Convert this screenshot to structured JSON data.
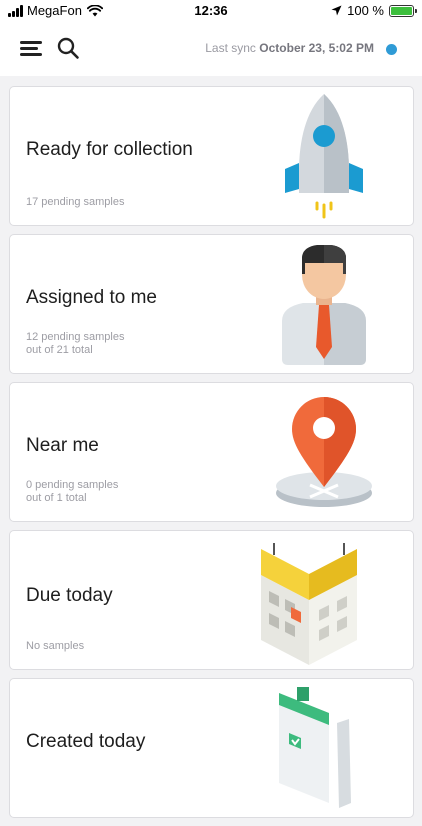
{
  "status_bar": {
    "carrier": "MegaFon",
    "time": "12:36",
    "battery": "100 %"
  },
  "header": {
    "sync_label": "Last sync",
    "sync_time": "October 23, 5:02 PM",
    "sync_status_color": "#2f9bd6"
  },
  "cards": [
    {
      "title": "Ready for collection",
      "line1": "17 pending samples",
      "line2": "",
      "icon": "rocket-icon"
    },
    {
      "title": "Assigned to me",
      "line1": "12 pending samples",
      "line2": "out of 21 total",
      "icon": "person-icon"
    },
    {
      "title": "Near me",
      "line1": "0 pending samples",
      "line2": "out of 1 total",
      "icon": "map-pin-icon"
    },
    {
      "title": "Due today",
      "line1": "No samples",
      "line2": "",
      "icon": "calendar-icon"
    },
    {
      "title": "Created today",
      "line1": "",
      "line2": "",
      "icon": "clipboard-icon"
    }
  ]
}
